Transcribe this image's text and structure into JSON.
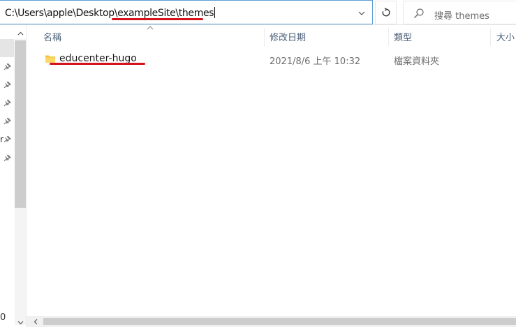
{
  "address_bar": {
    "path_prefix": "C:\\Users\\apple\\Desktop\\",
    "path_highlight": "exampleSite\\themes"
  },
  "search": {
    "placeholder": "搜尋 themes"
  },
  "columns": {
    "name": "名稱",
    "date_modified": "修改日期",
    "type": "類型",
    "size": "大小"
  },
  "sort": {
    "column": "name",
    "direction": "ascending"
  },
  "files": [
    {
      "name": "educenter-hugo",
      "date_modified": "2021/8/6 上午 10:32",
      "type": "檔案資料夾",
      "icon": "folder-icon"
    }
  ],
  "nav": {
    "pinned_count": 6,
    "truncated_labels": [
      "r",
      "0"
    ]
  },
  "colors": {
    "accent_border": "#5a9fd4",
    "annotation_red": "#d4121c",
    "folder_yellow": "#f6c343",
    "header_text": "#4c607a"
  }
}
